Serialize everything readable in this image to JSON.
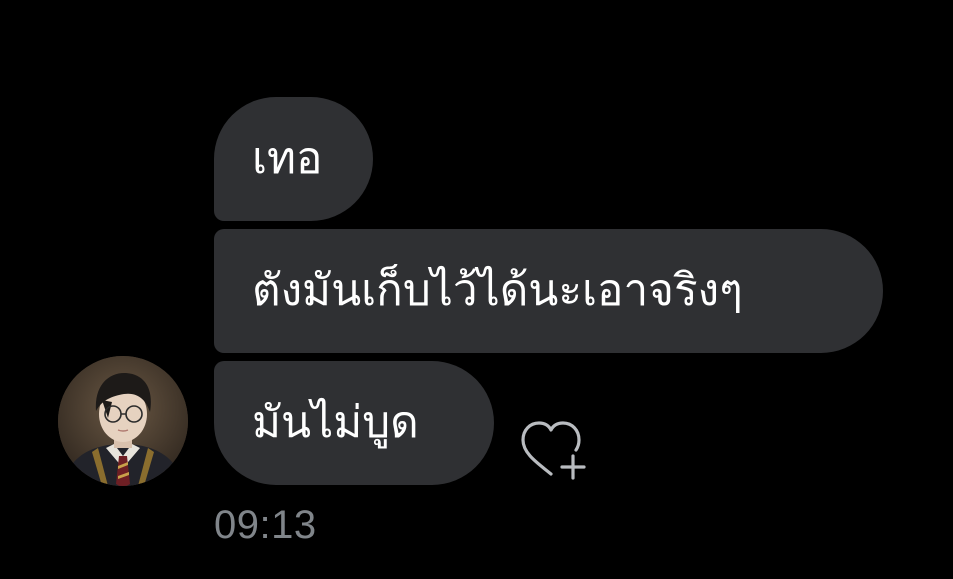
{
  "conversation": {
    "messages": [
      {
        "text": "เทอ"
      },
      {
        "text": "ตังมันเก็บไว้ได้นะเอาจริงๆ"
      },
      {
        "text": "มันไม่บูด"
      }
    ],
    "timestamp": "09:13",
    "sender_avatar": "avatar",
    "reaction_icon": "heart-add-icon"
  },
  "colors": {
    "background": "#000000",
    "bubble": "#2f3033",
    "bubble_text": "#ffffff",
    "timestamp": "#80858a",
    "icon": "#b9bcc0"
  }
}
